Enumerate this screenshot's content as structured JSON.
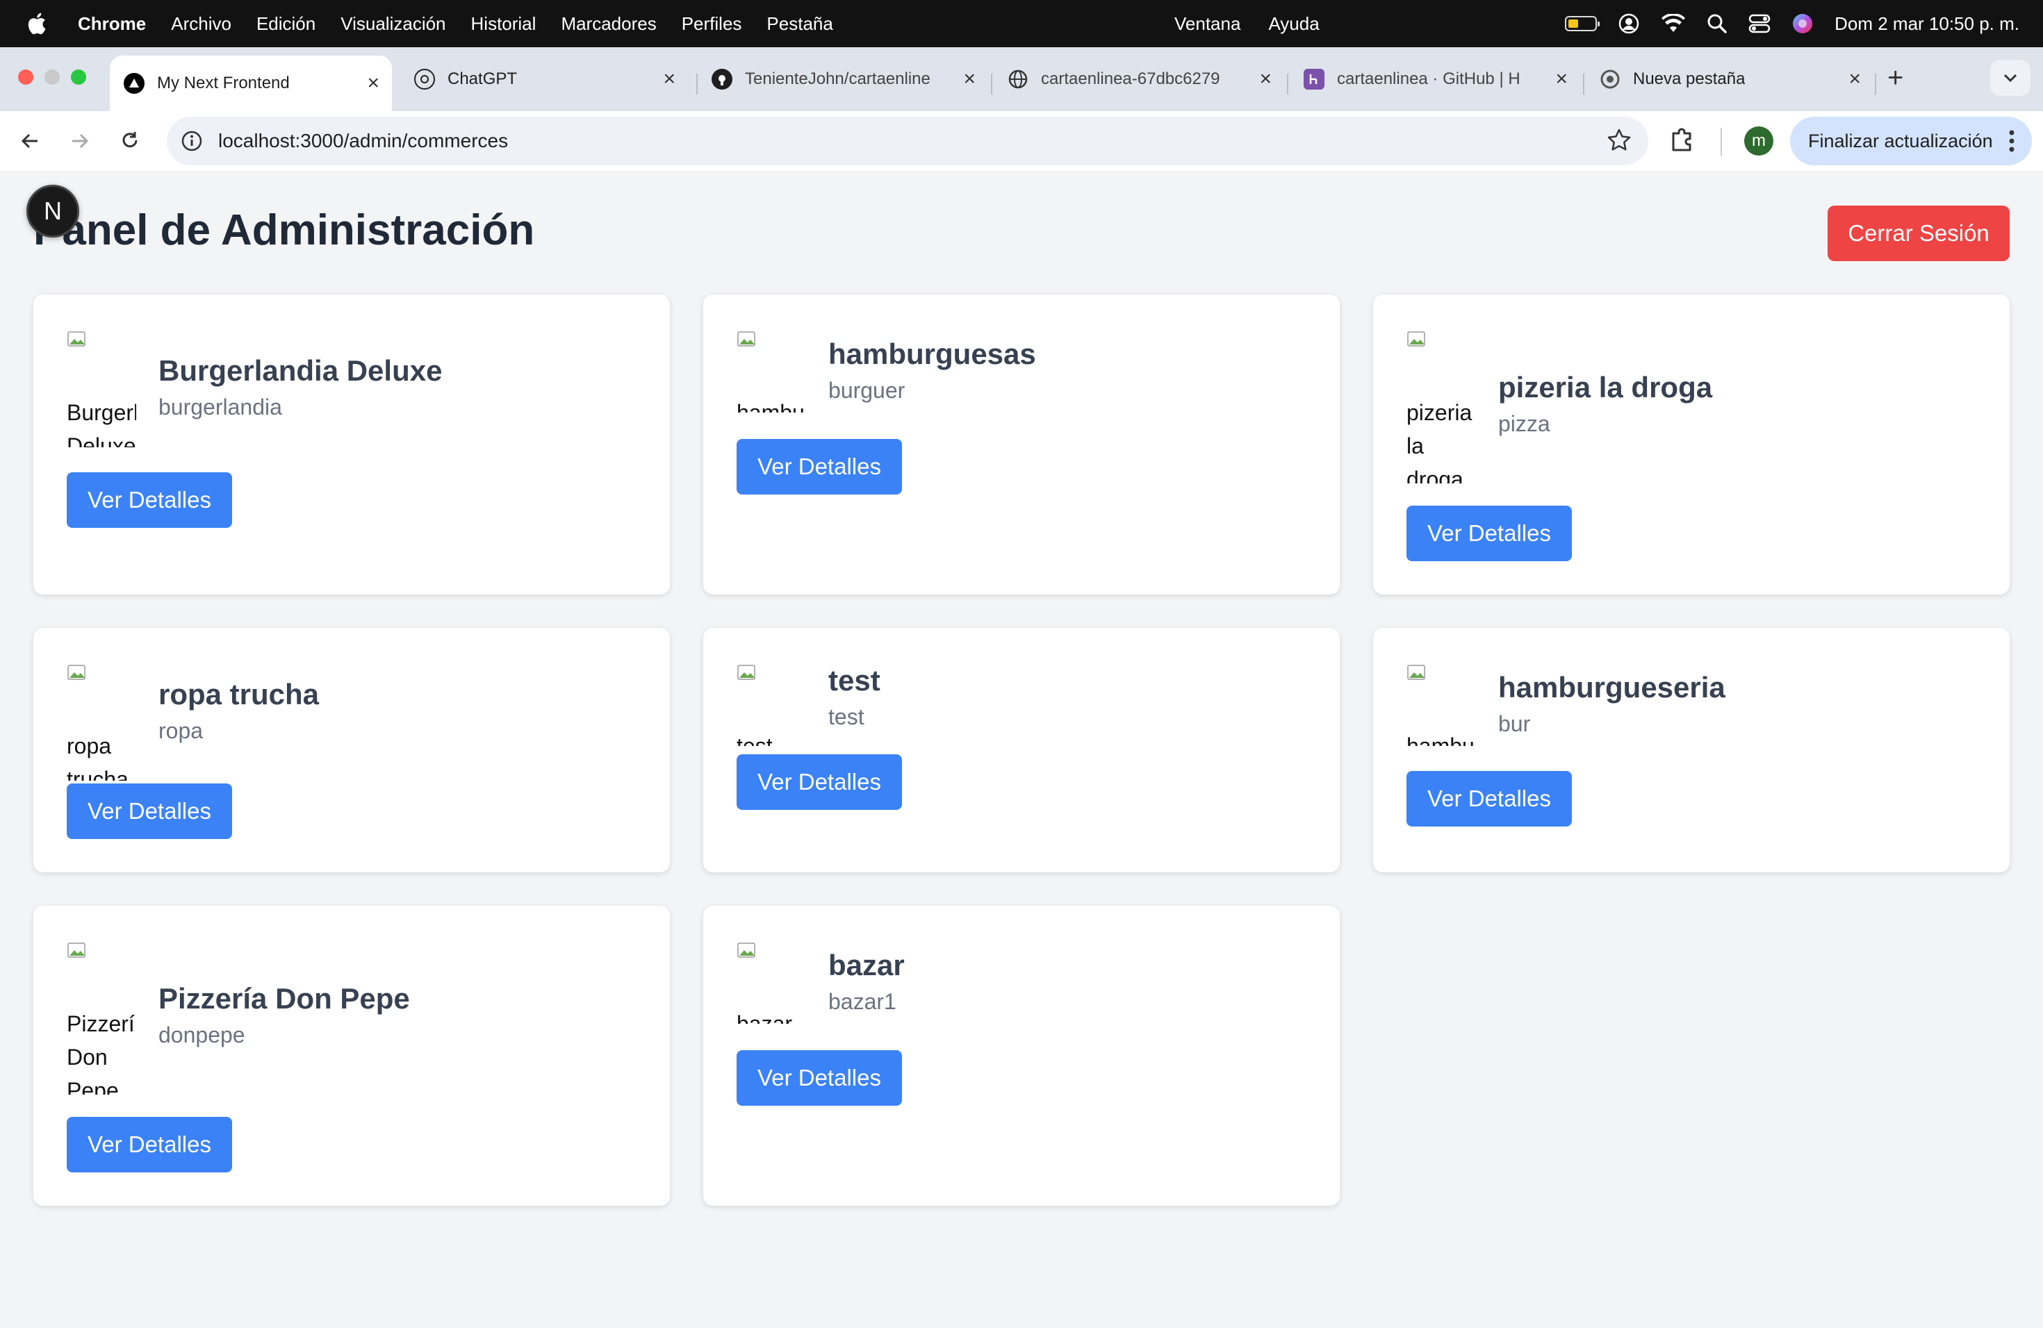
{
  "menubar": {
    "app": "Chrome",
    "items": [
      "Archivo",
      "Edición",
      "Visualización",
      "Historial",
      "Marcadores",
      "Perfiles",
      "Pestaña"
    ],
    "center_items": [
      "Ventana",
      "Ayuda"
    ],
    "clock": "Dom 2 mar 10:50 p. m."
  },
  "tabs": [
    {
      "label": "My Next Frontend",
      "icon": "nextjs-icon"
    },
    {
      "label": "ChatGPT",
      "icon": "openai-icon"
    },
    {
      "label": "TenienteJohn/cartaenline",
      "icon": "github-icon"
    },
    {
      "label": "cartaenlinea-67dbc6279",
      "icon": "globe-icon"
    },
    {
      "label": "cartaenlinea · GitHub | H",
      "icon": "heroku-icon"
    },
    {
      "label": "Nueva pestaña",
      "icon": "chrome-icon"
    }
  ],
  "toolbar": {
    "url": "localhost:3000/admin/commerces",
    "profile_initial": "m",
    "update_label": "Finalizar actualización"
  },
  "page": {
    "title": "Panel de Administración",
    "badge_letter": "N",
    "logout_label": "Cerrar Sesión",
    "details_label": "Ver Detalles"
  },
  "commerces": [
    {
      "name": "Burgerlandia Deluxe",
      "slug": "burgerlandia",
      "logo_alt": "Burgerl\nDeluxe\n'.ogo"
    },
    {
      "name": "hamburguesas",
      "slug": "burguer",
      "logo_alt": "hambu\n'.ogo"
    },
    {
      "name": "pizeria la droga",
      "slug": "pizza",
      "logo_alt": "pizeria\nla\ndroga\n'.ogo"
    },
    {
      "name": "ropa trucha",
      "slug": "ropa",
      "logo_alt": "ropa\ntrucha\n'.ogo"
    },
    {
      "name": "test",
      "slug": "test",
      "logo_alt": "test\n'.ogo"
    },
    {
      "name": "hamburgueseria",
      "slug": "bur",
      "logo_alt": "hambu\n'.ogo"
    },
    {
      "name": "Pizzería Don Pepe",
      "slug": "donpepe",
      "logo_alt": "Pizzerí\nDon\nPepe\n'.ogo"
    },
    {
      "name": "bazar",
      "slug": "bazar1",
      "logo_alt": "bazar\n'.ogo"
    }
  ],
  "colors": {
    "primary_button": "#3b82f6",
    "logout_button": "#ef4444",
    "page_background": "#f3f4f6"
  }
}
